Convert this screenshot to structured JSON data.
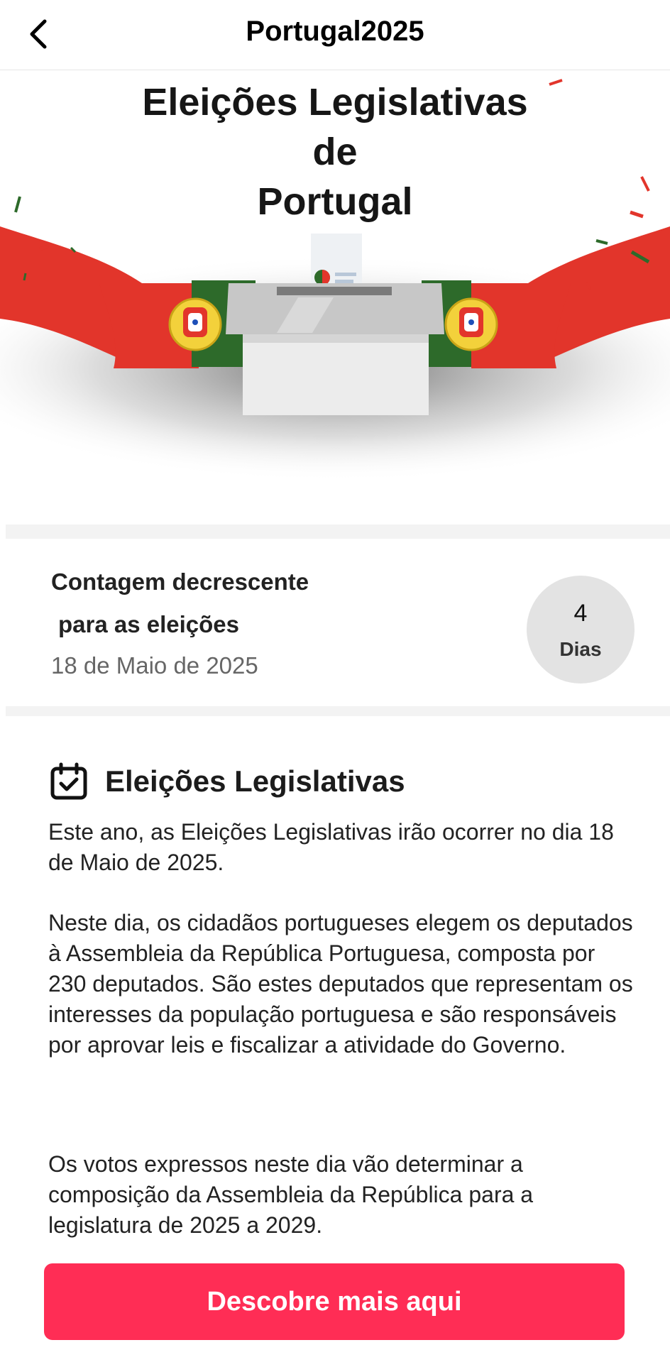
{
  "header": {
    "title": "Portugal2025",
    "back_icon": "chevron-left-icon"
  },
  "hero": {
    "title_lines": [
      "Eleições Legislativas",
      "de",
      "Portugal"
    ],
    "illustration": "ballot-box-with-portuguese-flag"
  },
  "countdown": {
    "line1": "Contagem decrescente",
    "line2": "para as eleições",
    "date": "18 de Maio de 2025",
    "days_value": "4",
    "days_label": "Dias"
  },
  "info": {
    "icon": "calendar-check-icon",
    "title": "Eleições Legislativas",
    "paragraphs": [
      "Este ano, as Eleições Legislativas irão ocorrer no dia 18 de Maio de 2025.",
      "Neste dia, os cidadãos portugueses elegem os deputados à Assembleia da República Portuguesa, composta por 230 deputados. São estes deputados que representam os interesses da população portuguesa e são responsáveis por aprovar leis e fiscalizar a atividade do Governo.",
      "Os votos expressos neste dia vão determinar a composição da Assembleia da República para a legislatura de 2025 a 2029."
    ]
  },
  "cta": {
    "label": "Descobre mais aqui"
  },
  "colors": {
    "accent": "#ff2d55",
    "flag_red": "#e2352b",
    "flag_green": "#2d6a2a",
    "days_circle": "#e3e3e3"
  }
}
